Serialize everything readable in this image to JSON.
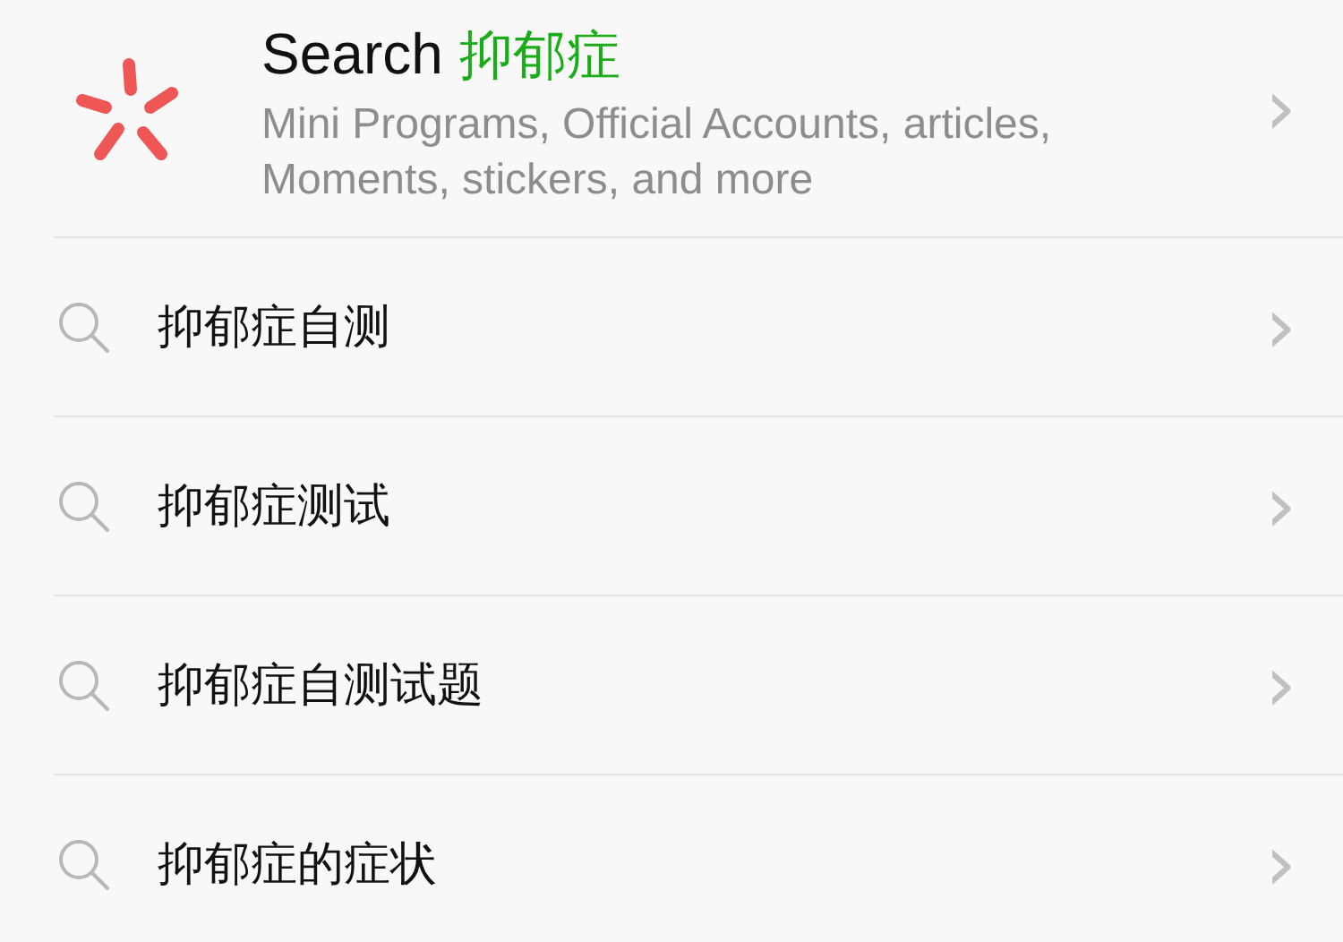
{
  "search_header": {
    "label": "Search",
    "keyword": "抑郁症",
    "description": "Mini Programs, Official Accounts, articles, Moments, stickers, and more",
    "chevron": "›"
  },
  "suggestions": [
    {
      "text": "抑郁症自测",
      "chevron": "›"
    },
    {
      "text": "抑郁症测试",
      "chevron": "›"
    },
    {
      "text": "抑郁症自测试题",
      "chevron": "›"
    },
    {
      "text": "抑郁症的症状",
      "chevron": "›"
    }
  ]
}
